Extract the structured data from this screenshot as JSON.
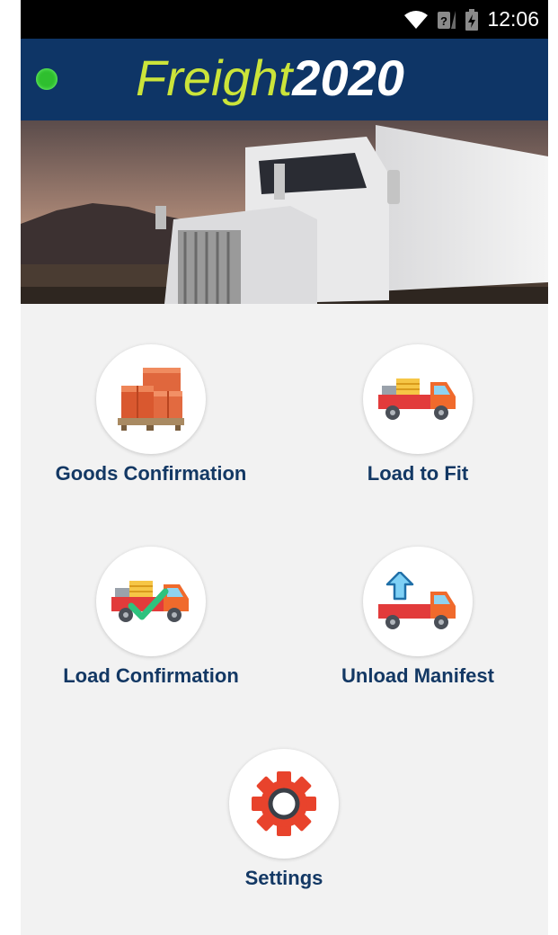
{
  "status_bar": {
    "time": "12:06",
    "icons": [
      "wifi-icon",
      "no-sim-icon",
      "battery-charging-icon"
    ]
  },
  "app_bar": {
    "brand_part1": "Freight",
    "brand_part2": "2020",
    "connection_color": "#2fbf2f"
  },
  "menu": {
    "items": [
      {
        "label": "Goods Confirmation",
        "icon": "stacked-boxes-icon"
      },
      {
        "label": "Load to Fit",
        "icon": "loaded-truck-icon"
      },
      {
        "label": "Load Confirmation",
        "icon": "truck-checkmark-icon"
      },
      {
        "label": "Unload Manifest",
        "icon": "truck-upload-arrow-icon"
      },
      {
        "label": "Settings",
        "icon": "gear-icon"
      }
    ]
  },
  "colors": {
    "app_bar": "#0e3566",
    "brand_accent": "#cbe43a",
    "label": "#133864",
    "background": "#f2f2f2"
  }
}
